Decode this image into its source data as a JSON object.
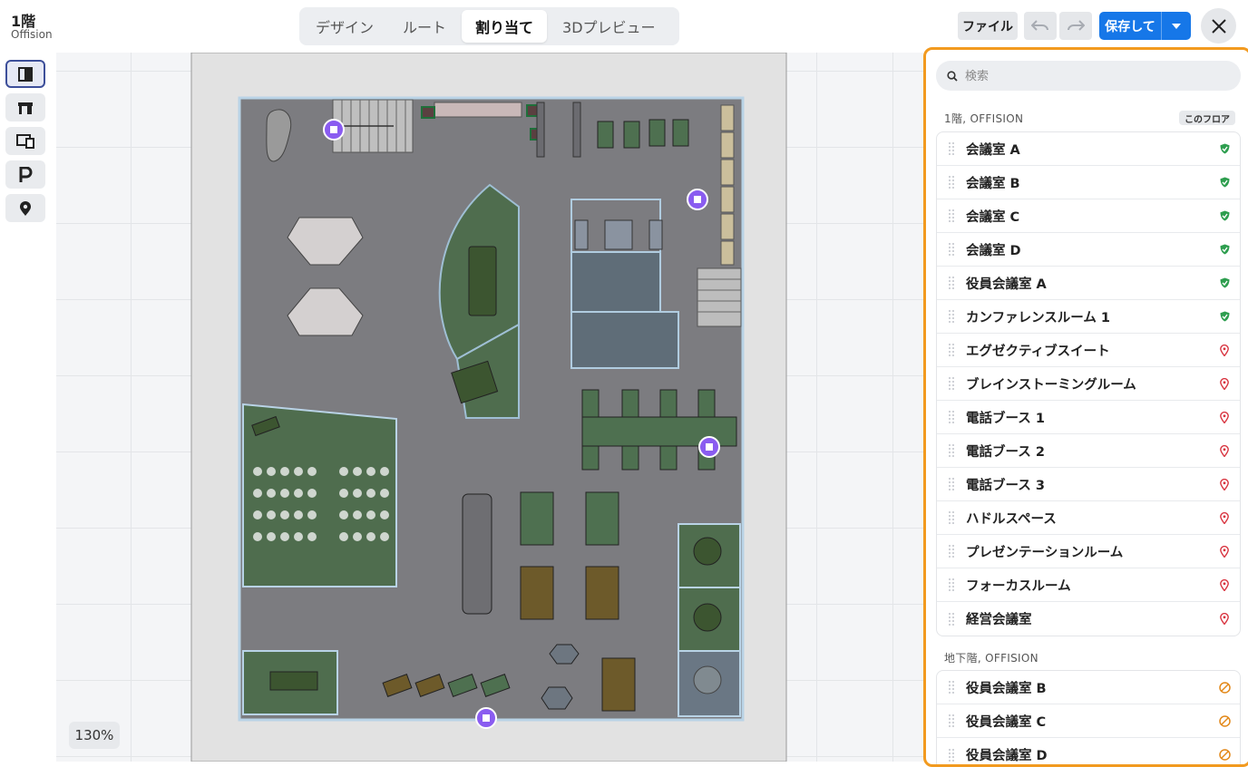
{
  "header": {
    "floor_title": "1階",
    "floor_subtitle": "Offision",
    "tabs": [
      {
        "label": "デザイン",
        "active": false
      },
      {
        "label": "ルート",
        "active": false
      },
      {
        "label": "割り当て",
        "active": true
      },
      {
        "label": "3Dプレビュー",
        "active": false
      }
    ],
    "file_label": "ファイル",
    "save_label": "保存して"
  },
  "toolrail": {
    "tools": [
      {
        "icon": "room-door-icon",
        "active": true
      },
      {
        "icon": "desk-icon",
        "active": false
      },
      {
        "icon": "devices-icon",
        "active": false
      },
      {
        "icon": "parking-icon",
        "active": false
      },
      {
        "icon": "location-pin-icon",
        "active": false
      }
    ]
  },
  "canvas": {
    "zoom": "130%"
  },
  "panel": {
    "search_placeholder": "検索",
    "groups": [
      {
        "title": "1階, OFFISION",
        "badge": "このフロア",
        "items": [
          {
            "label": "会議室 A",
            "status": "assigned"
          },
          {
            "label": "会議室 B",
            "status": "assigned"
          },
          {
            "label": "会議室 C",
            "status": "assigned"
          },
          {
            "label": "会議室 D",
            "status": "assigned"
          },
          {
            "label": "役員会議室 A",
            "status": "assigned"
          },
          {
            "label": "カンファレンスルーム 1",
            "status": "assigned"
          },
          {
            "label": "エグゼクティブスイート",
            "status": "unassigned"
          },
          {
            "label": "ブレインストーミングルーム",
            "status": "unassigned"
          },
          {
            "label": "電話ブース 1",
            "status": "unassigned"
          },
          {
            "label": "電話ブース 2",
            "status": "unassigned"
          },
          {
            "label": "電話ブース 3",
            "status": "unassigned"
          },
          {
            "label": "ハドルスペース",
            "status": "unassigned"
          },
          {
            "label": "プレゼンテーションルーム",
            "status": "unassigned"
          },
          {
            "label": "フォーカスルーム",
            "status": "unassigned"
          },
          {
            "label": "経営会議室",
            "status": "unassigned"
          }
        ]
      },
      {
        "title": "地下階, OFFISION",
        "items": [
          {
            "label": "役員会議室 B",
            "status": "other-floor"
          },
          {
            "label": "役員会議室 C",
            "status": "other-floor"
          },
          {
            "label": "役員会議室 D",
            "status": "other-floor"
          }
        ]
      }
    ]
  },
  "colors": {
    "accent": "#1677e8",
    "panel_border": "#f29a1f",
    "assigned": "#2e9e4f",
    "unassigned": "#d8333f",
    "other_floor": "#e3891a",
    "marker": "#8a5cf0"
  }
}
